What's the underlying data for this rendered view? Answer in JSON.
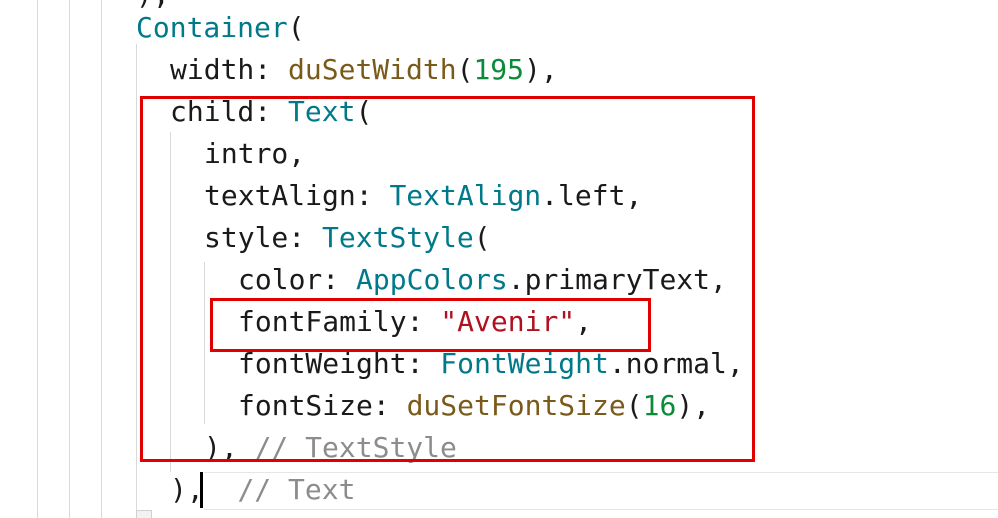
{
  "editor": {
    "partial_top_line": "),",
    "lines": {
      "container_open": {
        "cls": "Container",
        "punc": "("
      },
      "width": {
        "key": "width: ",
        "fn": "duSetWidth",
        "open": "(",
        "num": "195",
        "close": "),"
      },
      "child": {
        "key": "child: ",
        "cls": "Text",
        "punc": "("
      },
      "intro": {
        "text": "intro,"
      },
      "text_align": {
        "key": "textAlign: ",
        "cls": "TextAlign",
        "rest": ".left,"
      },
      "style": {
        "key": "style: ",
        "cls": "TextStyle",
        "punc": "("
      },
      "color": {
        "key": "color: ",
        "cls": "AppColors",
        "rest": ".primaryText,"
      },
      "font_family": {
        "key": "fontFamily: ",
        "str": "\"Avenir\"",
        "rest": ","
      },
      "font_weight": {
        "key": "fontWeight: ",
        "cls": "FontWeight",
        "rest": ".normal,"
      },
      "font_size": {
        "key": "fontSize: ",
        "fn": "duSetFontSize",
        "open": "(",
        "num": "16",
        "close": "),"
      },
      "text_style_close": {
        "punc": "),",
        "comment": "// TextStyle"
      },
      "text_close": {
        "punc": "),",
        "comment": "// Text"
      }
    },
    "colors": {
      "class": "#00798a",
      "function": "#7a5a1a",
      "number": "#0b8a3a",
      "string": "#b01020",
      "comment": "#8c8c8c",
      "highlight": "#e00000"
    }
  }
}
